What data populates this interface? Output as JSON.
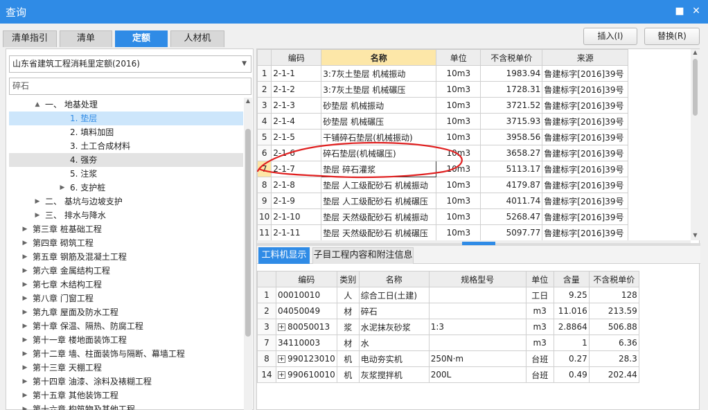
{
  "window": {
    "title": "查询",
    "minimize_glyph": "■",
    "close_glyph": "✕"
  },
  "tabs": [
    {
      "label": "清单指引"
    },
    {
      "label": "清单"
    },
    {
      "label": "定额"
    },
    {
      "label": "人材机"
    }
  ],
  "buttons": {
    "insert": "插入(I)",
    "replace": "替换(R)"
  },
  "left": {
    "quota_select": "山东省建筑工程消耗里定额(2016)",
    "search_value": "碎石",
    "tree": [
      {
        "label": "一、 地基处理",
        "exp": "▲"
      },
      {
        "label": "1. 垫层",
        "exp": ""
      },
      {
        "label": "2. 填料加固",
        "exp": ""
      },
      {
        "label": "3. 土工合成材料",
        "exp": ""
      },
      {
        "label": "4. 强夯",
        "exp": ""
      },
      {
        "label": "5. 注浆",
        "exp": ""
      },
      {
        "label": "6. 支护桩",
        "exp": "▶"
      },
      {
        "label": "二、 基坑与边坡支护",
        "exp": "▶"
      },
      {
        "label": "三、 排水与降水",
        "exp": "▶"
      },
      {
        "label": "第三章 桩基础工程",
        "exp": "▶"
      },
      {
        "label": "第四章 砌筑工程",
        "exp": "▶"
      },
      {
        "label": "第五章 钢筋及混凝土工程",
        "exp": "▶"
      },
      {
        "label": "第六章 金属结构工程",
        "exp": "▶"
      },
      {
        "label": "第七章 木结构工程",
        "exp": "▶"
      },
      {
        "label": "第八章 门窗工程",
        "exp": "▶"
      },
      {
        "label": "第九章 屋面及防水工程",
        "exp": "▶"
      },
      {
        "label": "第十章 保温、隔热、防腐工程",
        "exp": "▶"
      },
      {
        "label": "第十一章 楼地面装饰工程",
        "exp": "▶"
      },
      {
        "label": "第十二章 墙、柱面装饰与隔断、幕墙工程",
        "exp": "▶"
      },
      {
        "label": "第十三章 天棚工程",
        "exp": "▶"
      },
      {
        "label": "第十四章 油漆、涂料及裱糊工程",
        "exp": "▶"
      },
      {
        "label": "第十五章 其他装饰工程",
        "exp": "▶"
      },
      {
        "label": "第十六章 构筑物及其他工程",
        "exp": "▶"
      }
    ]
  },
  "quota_table": {
    "headers": [
      "",
      "编码",
      "名称",
      "单位",
      "不含税单价",
      "来源"
    ],
    "rows": [
      [
        "1",
        "2-1-1",
        "3:7灰土垫层 机械振动",
        "10m3",
        "1983.94",
        "鲁建标字[2016]39号"
      ],
      [
        "2",
        "2-1-2",
        "3:7灰土垫层 机械碾压",
        "10m3",
        "1728.31",
        "鲁建标字[2016]39号"
      ],
      [
        "3",
        "2-1-3",
        "砂垫层 机械振动",
        "10m3",
        "3721.52",
        "鲁建标字[2016]39号"
      ],
      [
        "4",
        "2-1-4",
        "砂垫层 机械碾压",
        "10m3",
        "3715.93",
        "鲁建标字[2016]39号"
      ],
      [
        "5",
        "2-1-5",
        "干铺碎石垫层(机械振动)",
        "10m3",
        "3958.56",
        "鲁建标字[2016]39号"
      ],
      [
        "6",
        "2-1-6",
        "碎石垫层(机械碾压)",
        "10m3",
        "3658.27",
        "鲁建标字[2016]39号"
      ],
      [
        "7",
        "2-1-7",
        "垫层 碎石灌浆",
        "10m3",
        "5113.17",
        "鲁建标字[2016]39号"
      ],
      [
        "8",
        "2-1-8",
        "垫层 人工级配砂石 机械振动",
        "10m3",
        "4179.87",
        "鲁建标字[2016]39号"
      ],
      [
        "9",
        "2-1-9",
        "垫层 人工级配砂石 机械碾压",
        "10m3",
        "4011.74",
        "鲁建标字[2016]39号"
      ],
      [
        "10",
        "2-1-10",
        "垫层 天然级配砂石 机械振动",
        "10m3",
        "5268.47",
        "鲁建标字[2016]39号"
      ],
      [
        "11",
        "2-1-11",
        "垫层 天然级配砂石 机械碾压",
        "10m3",
        "5097.77",
        "鲁建标字[2016]39号"
      ]
    ]
  },
  "subtabs": [
    {
      "label": "工料机显示"
    },
    {
      "label": "子目工程内容和附注信息"
    }
  ],
  "material_table": {
    "headers": [
      "",
      "编码",
      "类别",
      "名称",
      "规格型号",
      "单位",
      "含量",
      "不含税单价"
    ],
    "rows": [
      [
        "1",
        "00010010",
        "人",
        "综合工日(土建)",
        "",
        "工日",
        "9.25",
        "128",
        false
      ],
      [
        "2",
        "04050049",
        "材",
        "碎石",
        "",
        "m3",
        "11.016",
        "213.59",
        false
      ],
      [
        "3",
        "80050013",
        "浆",
        "水泥抹灰砂浆",
        "1:3",
        "m3",
        "2.8864",
        "506.88",
        true
      ],
      [
        "7",
        "34110003",
        "材",
        "水",
        "",
        "m3",
        "1",
        "6.36",
        false
      ],
      [
        "8",
        "990123010",
        "机",
        "电动夯实机",
        "250N·m",
        "台班",
        "0.27",
        "28.3",
        true
      ],
      [
        "14",
        "990610010",
        "机",
        "灰浆搅拌机",
        "200L",
        "台班",
        "0.49",
        "202.44",
        true
      ]
    ]
  },
  "colors": {
    "accent": "#2f8be6",
    "header_highlight": "#fde7a8",
    "annotation": "#e02020",
    "tree_selected": "#cde6fb"
  }
}
